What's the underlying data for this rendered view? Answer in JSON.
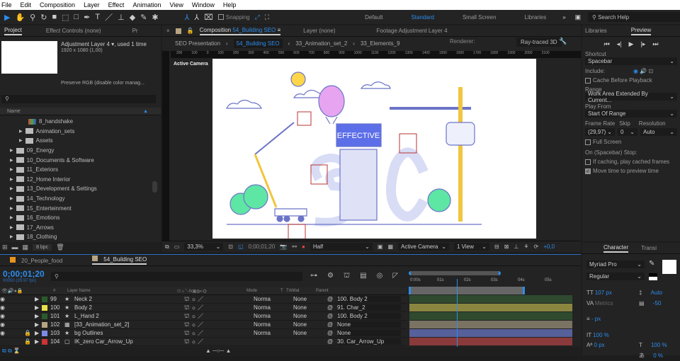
{
  "menu": [
    "File",
    "Edit",
    "Composition",
    "Layer",
    "Effect",
    "Animation",
    "View",
    "Window",
    "Help"
  ],
  "toolbar": {
    "snapping": "Snapping",
    "workspaces": [
      "Default",
      "Standard",
      "Small Screen",
      "Libraries"
    ],
    "active_workspace": "Standard",
    "search_placeholder": "Search Help"
  },
  "project": {
    "tabs": [
      "Project",
      "Effect Controls (none)",
      "Pr"
    ],
    "item_name": "Adjustment Layer 4",
    "item_used": ", used 1 time",
    "item_dims": "1920 x 1080 (1,00)",
    "preserve": "Preserve RGB (disable color manag...",
    "name_header": "Name",
    "bpc": "8 bpc",
    "tree": [
      {
        "label": "8_handshake",
        "type": "comp",
        "indent": 2
      },
      {
        "label": "Animation_sets",
        "type": "folder",
        "indent": 1
      },
      {
        "label": "Assets",
        "type": "folder",
        "indent": 1
      },
      {
        "label": "09_Energy",
        "type": "folder",
        "indent": 0
      },
      {
        "label": "10_Documents & Software",
        "type": "folder",
        "indent": 0
      },
      {
        "label": "11_Exteriors",
        "type": "folder",
        "indent": 0
      },
      {
        "label": "12_Home Interior",
        "type": "folder",
        "indent": 0
      },
      {
        "label": "13_Development & Settings",
        "type": "folder",
        "indent": 0
      },
      {
        "label": "14_Technology",
        "type": "folder",
        "indent": 0
      },
      {
        "label": "15_Enterteinment",
        "type": "folder",
        "indent": 0
      },
      {
        "label": "16_Emotions",
        "type": "folder",
        "indent": 0
      },
      {
        "label": "17_Arrows",
        "type": "folder",
        "indent": 0
      },
      {
        "label": "18_Clothing",
        "type": "folder",
        "indent": 0
      }
    ]
  },
  "comp": {
    "tab_prefix": "Composition",
    "tab_name": "54_Building SEO",
    "layer_tab": "Layer (none)",
    "footage_tab": "Footage Adjustment Layer 4",
    "breadcrumbs": [
      "SEO Presentation",
      "54_Building SEO",
      "33_Animation_set_2",
      "33_Elements_9"
    ],
    "renderer_label": "Renderer:",
    "renderer": "Ray-traced 3D",
    "ruler": [
      "200",
      "100",
      "0",
      "100",
      "200",
      "300",
      "400",
      "500",
      "600",
      "700",
      "800",
      "900",
      "1000",
      "1100",
      "1200",
      "1300",
      "1400",
      "1500",
      "1600",
      "1700",
      "1800",
      "1900",
      "2000",
      "2100"
    ],
    "camera_label": "Active Camera",
    "art_text": "EFFECTIVE",
    "viewer_toolbar": {
      "zoom": "33,3%",
      "timecode": "0;00;01;20",
      "resolution": "Half",
      "camera": "Active Camera",
      "views": "1 View",
      "exposure": "+0,0"
    }
  },
  "preview": {
    "tabs": [
      "Libraries",
      "Preview"
    ],
    "shortcut_label": "Shortcut",
    "shortcut": "Spacebar",
    "include_label": "Include:",
    "cache": "Cache Before Playback",
    "range_label": "Range",
    "range": "Work Area Extended By Current...",
    "play_from_label": "Play From",
    "play_from": "Start Of Range",
    "frame_rate_label": "Frame Rate",
    "skip_label": "Skip",
    "resolution_label": "Resolution",
    "frame_rate": "(29,97)",
    "skip": "0",
    "resolution": "Auto",
    "full_screen": "Full Screen",
    "stop_label": "On (Spacebar) Stop:",
    "if_caching": "If caching, play cached frames",
    "move_time": "Move time to preview time",
    "move_time_checked": true
  },
  "timeline": {
    "tabs": [
      "20_People_food",
      "54_Building SEO"
    ],
    "tab_colors": [
      "#e8941f",
      "#b8a482"
    ],
    "timecode": "0;00;01;20",
    "frames": "00050 (29.97 fps)",
    "headers": {
      "num": "#",
      "name": "Layer Name",
      "mode": "Mode",
      "t": "T",
      "trkmat": "TrkMat",
      "parent": "Parent"
    },
    "ruler": [
      "0:00s",
      "01s",
      "02s",
      "03s",
      "04s",
      "05s"
    ],
    "playhead_seconds": 1.67,
    "layers": [
      {
        "num": "99",
        "name": "Neck 2",
        "color": "#2b5a2b",
        "mode": "Norma",
        "trkmat": "None",
        "parent": "100. Body 2",
        "bar": "#2f4a2f",
        "eye": true,
        "lock": false
      },
      {
        "num": "100",
        "name": "Body 2",
        "color": "#e8e04a",
        "mode": "Norma",
        "trkmat": "None",
        "parent": "91. Char_2",
        "bar": "#8a8640",
        "eye": true,
        "lock": false
      },
      {
        "num": "101",
        "name": "L_Hand 2",
        "color": "#2b5a2b",
        "mode": "Norma",
        "trkmat": "None",
        "parent": "100. Body 2",
        "bar": "#2f4a2f",
        "eye": true,
        "lock": false
      },
      {
        "num": "102",
        "name": "[33_Animation_set_2]",
        "color": "#b8a482",
        "mode": "Norma",
        "trkmat": "None",
        "parent": "None",
        "bar": "#7a7262",
        "eye": true,
        "lock": false
      },
      {
        "num": "103",
        "name": "bg Outlines",
        "color": "#7b8ce8",
        "mode": "Norma",
        "trkmat": "None",
        "parent": "None",
        "bar": "#56609a",
        "eye": true,
        "lock": true
      },
      {
        "num": "104",
        "name": "IK_zero Car_Arrow_Up",
        "color": "#cc3333",
        "mode": "",
        "trkmat": "",
        "parent": "30. Car_Arrow_Up",
        "bar": "#8a3a3a",
        "eye": false,
        "lock": true
      }
    ],
    "markers": [
      "2",
      "1"
    ]
  },
  "character": {
    "tabs": [
      "Character",
      "Transi"
    ],
    "font": "Myriad Pro",
    "style": "Regular",
    "size": "107 px",
    "leading": "Auto",
    "kerning": "Metrics",
    "tracking": "-50",
    "stroke": "- px",
    "vscale": "100 %",
    "hscale": "100 %",
    "baseline": "0 px",
    "tsume": "0 %"
  }
}
